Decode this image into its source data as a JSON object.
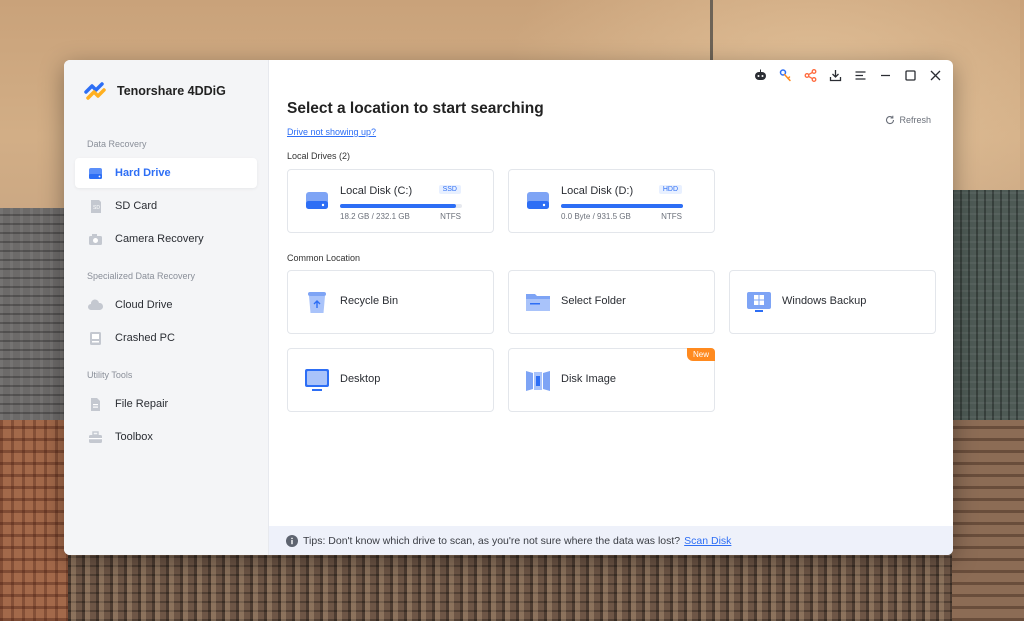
{
  "app": {
    "name": "Tenorshare 4DDiG"
  },
  "sidebar": {
    "sections": [
      {
        "label": "Data Recovery",
        "items": [
          {
            "label": "Hard Drive",
            "icon": "hard-drive-icon",
            "active": true
          },
          {
            "label": "SD Card",
            "icon": "sd-card-icon"
          },
          {
            "label": "Camera Recovery",
            "icon": "camera-icon"
          }
        ]
      },
      {
        "label": "Specialized Data Recovery",
        "items": [
          {
            "label": "Cloud Drive",
            "icon": "cloud-icon"
          },
          {
            "label": "Crashed PC",
            "icon": "crashed-pc-icon"
          }
        ]
      },
      {
        "label": "Utility Tools",
        "items": [
          {
            "label": "File Repair",
            "icon": "file-repair-icon"
          },
          {
            "label": "Toolbox",
            "icon": "toolbox-icon"
          }
        ]
      }
    ]
  },
  "titlebar": {
    "icons": [
      "assistant-bot-icon",
      "key-icon",
      "share-icon",
      "download-icon",
      "menu-icon",
      "minimize-icon",
      "maximize-icon",
      "close-icon"
    ]
  },
  "main": {
    "title": "Select a location to start searching",
    "help_link": "Drive not showing up?",
    "refresh_label": "Refresh",
    "local_drives_label": "Local Drives (2)",
    "drives": [
      {
        "name": "Local Disk (C:)",
        "type": "SSD",
        "size": "18.2 GB / 232.1 GB",
        "fs": "NTFS",
        "used_fraction": 0.95
      },
      {
        "name": "Local Disk (D:)",
        "type": "HDD",
        "size": "0.0 Byte / 931.5 GB",
        "fs": "NTFS",
        "used_fraction": 1.0
      }
    ],
    "common_location_label": "Common Location",
    "locations": [
      {
        "name": "Recycle Bin",
        "icon": "recycle-bin-icon"
      },
      {
        "name": "Select Folder",
        "icon": "folder-icon"
      },
      {
        "name": "Windows Backup",
        "icon": "windows-backup-icon"
      },
      {
        "name": "Desktop",
        "icon": "desktop-icon"
      },
      {
        "name": "Disk Image",
        "icon": "disk-image-icon",
        "badge": "New"
      }
    ]
  },
  "tips": {
    "text": "Tips: Don't know which drive to scan, as you're not sure where the data was lost?",
    "link": "Scan Disk"
  },
  "colors": {
    "accent": "#2d6ef5",
    "badge": "#ff8a1f",
    "sidebar_bg": "#f4f5f7",
    "tips_bg": "#eef1fa"
  }
}
